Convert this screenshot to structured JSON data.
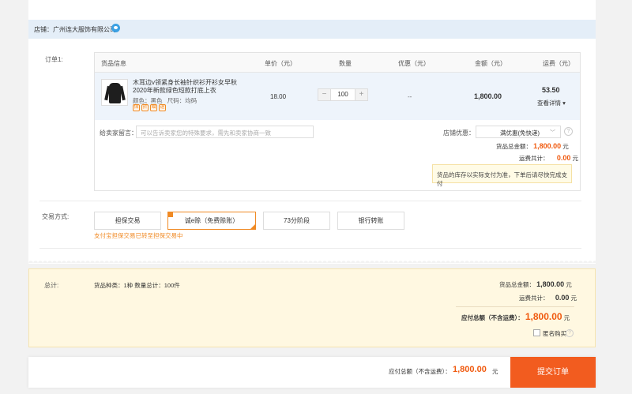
{
  "shop": {
    "label": "店铺：广州连大服饰有限公司",
    "icon": "wangwang-chat-icon"
  },
  "order": {
    "label": "订单1:",
    "columns": [
      "货品信息",
      "单价（元）",
      "数量",
      "优惠（元）",
      "金额（元）",
      "运费（元）"
    ],
    "product": {
      "name": "木耳边v领紧身长袖针织衫开衫女早秋2020年新款绿色短款打底上衣",
      "color_label": "颜色：",
      "color": "黑色",
      "size_label": "尺码：",
      "size": "均码",
      "badges": [
        "保",
        "折",
        "赠",
        "退"
      ],
      "unit_price": "18.00",
      "quantity": "100",
      "discount": "--",
      "amount": "1,800.00",
      "freight": "53.50",
      "freight_detail": "查看详情 ▾"
    },
    "message": {
      "label": "给卖家留言：",
      "placeholder": "可以告诉卖家您的特殊要求，需先和卖家协商一致"
    },
    "coupon": {
      "label": "店铺优惠：",
      "value": "满优惠(免快递)"
    },
    "goods_total_label": "货品总金额：",
    "goods_total": "1,800.00",
    "freight_total_label": "运费共计：",
    "freight_total": "0.00",
    "currency_unit": "元",
    "notice": "货品的库存以实际支付为准，下单后请尽快完成支付"
  },
  "payment": {
    "label": "交易方式:",
    "options": [
      "担保交易",
      "诚e赊（免费赊账）",
      "73分阶段",
      "银行转账"
    ],
    "selected_index": 1,
    "tip": "支付宝担保交易已转至担保交易中"
  },
  "summary": {
    "label": "总计:",
    "kinds_text": "货品种类：1种   数量总计：100件",
    "goods_total_label": "货品总金额：",
    "goods_total": "1,800.00",
    "freight_label": "运费共计：",
    "freight": "0.00",
    "payable_label": "应付总额（不含运费）：",
    "payable": "1,800.00",
    "unit": "元",
    "anonymous_label": "匿名购买"
  },
  "footer": {
    "payable_label": "应付总额（不含运费）：",
    "payable": "1,800.00",
    "unit": "元",
    "submit_label": "提交订单"
  },
  "colors": {
    "accent": "#f25c1f",
    "shop_bar": "#e4eef8",
    "summary_bg": "#fff8e1"
  }
}
